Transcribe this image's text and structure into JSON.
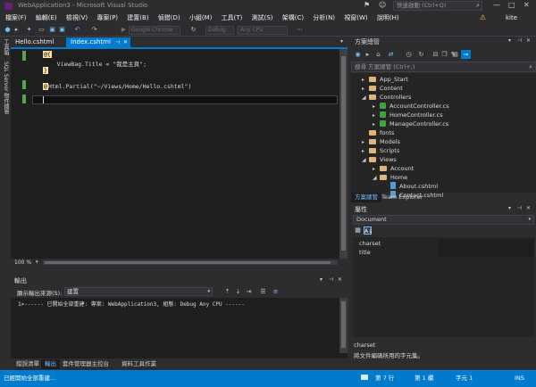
{
  "window": {
    "title": "WebApplication3 - Microsoft Visual Studio",
    "quick_launch_placeholder": "快速啟動 (Ctrl+Q)",
    "user": "kite"
  },
  "menu": [
    "檔案(F)",
    "編輯(E)",
    "檢視(V)",
    "專案(P)",
    "建置(B)",
    "偵錯(D)",
    "小組(M)",
    "工具(T)",
    "測試(S)",
    "架構(C)",
    "分析(N)",
    "視窗(W)",
    "說明(H)"
  ],
  "toolbar": {
    "browser": "Google Chrome",
    "config": "Debug",
    "platform": "Any CPU"
  },
  "left_strip": {
    "toolbox": "工具箱",
    "sql": "SQL Server 物件總管"
  },
  "doc_tabs": [
    {
      "label": "Hello.cshtml",
      "active": false
    },
    {
      "label": "Index.cshtml",
      "active": true
    }
  ],
  "editor": {
    "lines": [
      {
        "razor": "@{",
        "rest": ""
      },
      {
        "razor": "",
        "rest": "    ViewBag.Title = \"我是主頁\";"
      },
      {
        "razor": "}",
        "rest": ""
      },
      {
        "razor": "",
        "rest": ""
      },
      {
        "razor": "@",
        "rest": "Html.Partial(\"~/Views/Home/Hello.cshtml\")"
      }
    ],
    "zoom": "100 %"
  },
  "output": {
    "title": "輸出",
    "source_label": "顯示輸出來源(S):",
    "source_value": "建置",
    "lines": [
      "1>------ 已開始全部重建: 專案: WebApplication3, 組態: Debug Any CPU ------"
    ]
  },
  "bottom_tabs": [
    "錯誤清單",
    "輸出",
    "套件管理器主控台",
    "資料工具作業"
  ],
  "solution_explorer": {
    "title": "方案總管",
    "search_placeholder": "搜尋 方案總管 (Ctrl+;)",
    "items": [
      {
        "label": "App_Start",
        "type": "folder",
        "level": 1,
        "expander": "▸"
      },
      {
        "label": "Content",
        "type": "folder",
        "level": 1,
        "expander": "▸"
      },
      {
        "label": "Controllers",
        "type": "folder",
        "level": 1,
        "expander": "◢"
      },
      {
        "label": "AccountController.cs",
        "type": "cs",
        "level": 2,
        "expander": "▸"
      },
      {
        "label": "HomeController.cs",
        "type": "cs",
        "level": 2,
        "expander": "▸"
      },
      {
        "label": "ManageController.cs",
        "type": "cs",
        "level": 2,
        "expander": "▸"
      },
      {
        "label": "fonts",
        "type": "folder",
        "level": 1,
        "expander": ""
      },
      {
        "label": "Models",
        "type": "folder",
        "level": 1,
        "expander": "▸"
      },
      {
        "label": "Scripts",
        "type": "folder",
        "level": 1,
        "expander": "▸"
      },
      {
        "label": "Views",
        "type": "folder",
        "level": 1,
        "expander": "◢"
      },
      {
        "label": "Account",
        "type": "folder",
        "level": 2,
        "expander": "▸"
      },
      {
        "label": "Home",
        "type": "folder",
        "level": 2,
        "expander": "◢"
      },
      {
        "label": "About.cshtml",
        "type": "file",
        "level": 3,
        "expander": ""
      },
      {
        "label": "Contact.cshtml",
        "type": "file",
        "level": 3,
        "expander": ""
      }
    ],
    "tabs": [
      "方案總管",
      "Team Explorer"
    ]
  },
  "properties": {
    "title": "屬性",
    "object": "Document",
    "rows": [
      "charset",
      "title"
    ],
    "desc_title": "charset",
    "desc_text": "將文件編碼所用的字元集。"
  },
  "status": {
    "left": "已經開始全部重建...",
    "line": "第 7 行",
    "col": "第 1 欄",
    "ch": "字元 1",
    "mode": "INS"
  },
  "colors": {
    "accent": "#007acc",
    "editor_bg": "#1e1e1e",
    "chrome_bg": "#2d2d30",
    "razor_bg": "#fde7a2"
  }
}
